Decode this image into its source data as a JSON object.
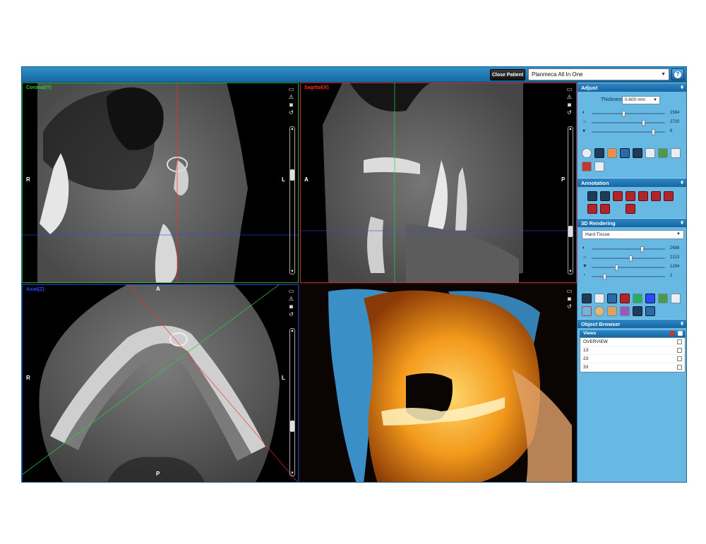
{
  "topbar": {
    "close_patient_label": "Close Patient",
    "device_selected": "Planmeca All In One"
  },
  "viewports": {
    "coronal": {
      "label": "Coronal(Y)",
      "label_color": "#2ecc40",
      "left": "R",
      "right": "L"
    },
    "sagittal": {
      "label": "Sagittal(X)",
      "label_color": "#ff2a2a",
      "left": "A",
      "right": "P"
    },
    "axial": {
      "label": "Axial(Z)",
      "label_color": "#2a4cff",
      "left": "R",
      "right": "L",
      "top": "A",
      "bottom": "P"
    }
  },
  "panel": {
    "adjust": {
      "title": "Adjust",
      "thickness_label": "Thickness",
      "thickness_value": "0.600 mm",
      "sliders": [
        {
          "icon": "contrast-icon",
          "value": "1584",
          "level": 0.42
        },
        {
          "icon": "brightness-icon",
          "value": "2720",
          "level": 0.7
        },
        {
          "icon": "sharpness-icon",
          "value": "6",
          "level": 0.84
        }
      ]
    },
    "annotation": {
      "title": "Annotation"
    },
    "rendering": {
      "title": "3D Rendering",
      "mode": "Hard Tissue",
      "sliders": [
        {
          "icon": "contrast-icon",
          "value": "2688",
          "level": 0.68
        },
        {
          "icon": "brightness-icon",
          "value": "2113",
          "level": 0.52
        },
        {
          "icon": "opacity-icon",
          "value": "1294",
          "level": 0.32
        },
        {
          "icon": "level-icon",
          "value": "2",
          "level": 0.15
        }
      ]
    },
    "object_browser": {
      "title": "Object Browser",
      "views_label": "Views",
      "views": [
        "OVERVIEW",
        "13",
        "23",
        "33"
      ]
    }
  },
  "colors": {
    "accent_blue": "#1766a0",
    "panel_bg": "#68b8e4",
    "crosshair_red": "#ff2a2a",
    "crosshair_green": "#2ecc40",
    "crosshair_blue": "#2a4cff"
  }
}
